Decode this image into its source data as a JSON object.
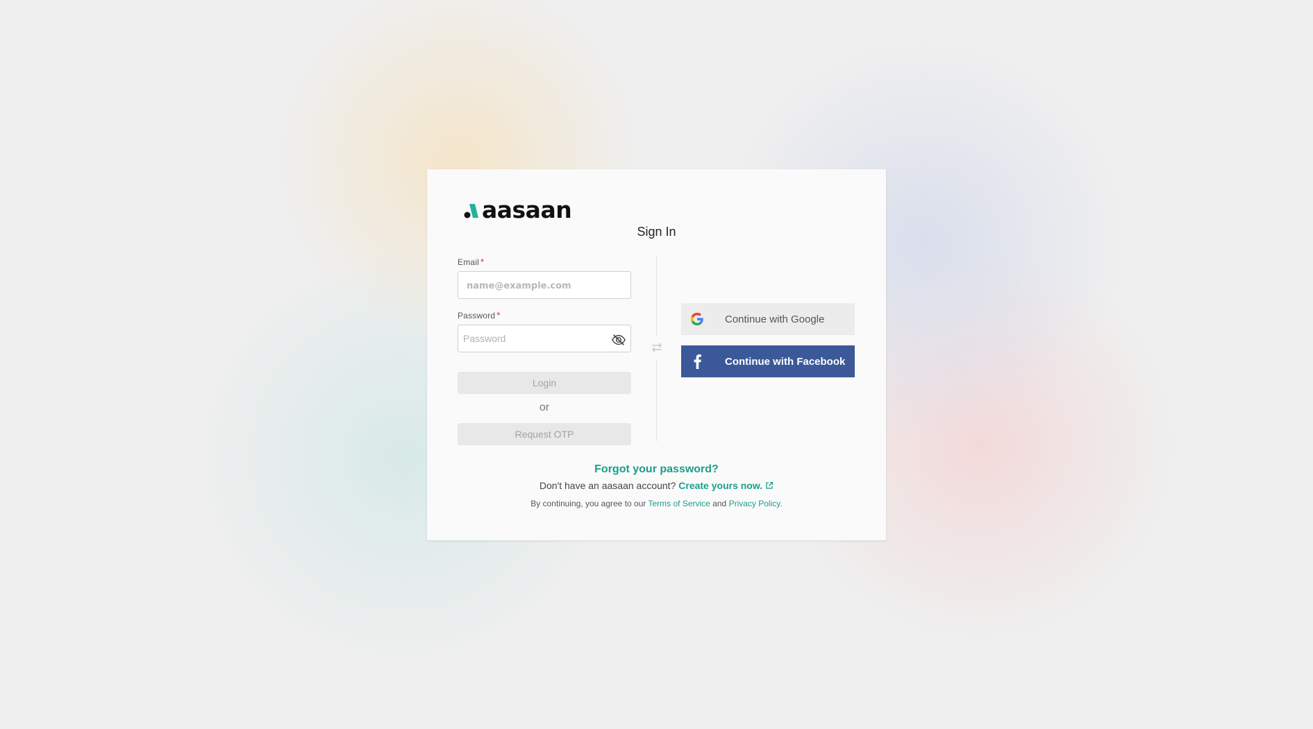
{
  "brand": {
    "name": "aasaan",
    "mark_colors": [
      "#1fb39a",
      "#111111"
    ]
  },
  "page": {
    "title": "Sign In"
  },
  "form": {
    "email_label": "Email",
    "email_placeholder": "name@example.com",
    "email_value": "",
    "password_label": "Password",
    "password_placeholder": "Password",
    "password_value": "",
    "required_marker": "*",
    "login_label": "Login",
    "or_label": "or",
    "otp_label": "Request OTP"
  },
  "social": {
    "google_label": "Continue with Google",
    "facebook_label": "Continue with Facebook",
    "facebook_color": "#3b5998"
  },
  "footer": {
    "forgot_label": "Forgot your password?",
    "account_prompt": "Don't have an aasaan account?",
    "create_label": "Create yours now.",
    "terms_prefix": "By continuing, you agree to our",
    "terms_link": "Terms of Service",
    "terms_and": "and",
    "privacy_link": "Privacy Policy",
    "terms_suffix": "."
  },
  "colors": {
    "accent": "#1a9e8c",
    "required": "#d32f2f"
  },
  "icons": [
    "aasaan-logo-icon",
    "eye-off-icon",
    "swap-icon",
    "google-icon",
    "facebook-icon",
    "external-link-icon"
  ]
}
